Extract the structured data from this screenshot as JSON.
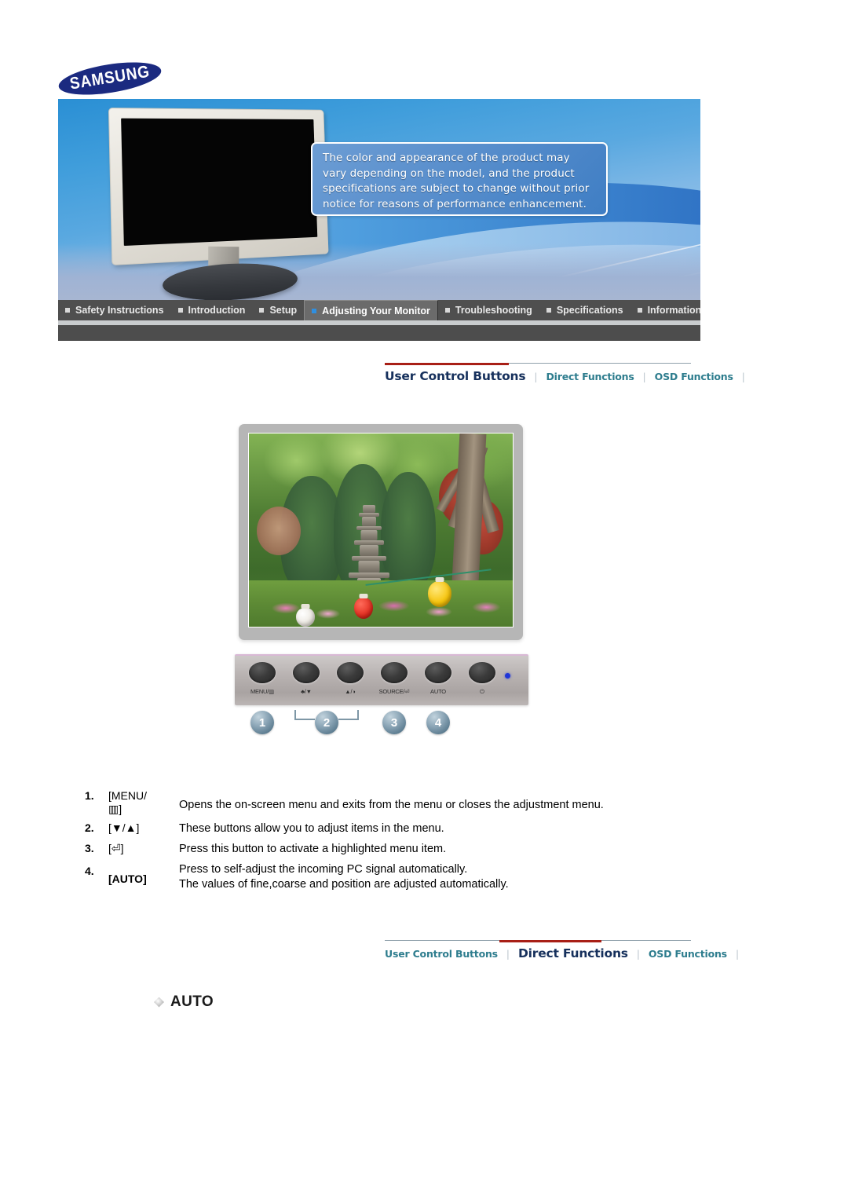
{
  "brand": {
    "logo_text": "SAMSUNG"
  },
  "header": {
    "disclaimer": "The color and appearance of the product may vary depending on the model, and the product specifications are subject to change without prior notice for reasons of performance enhancement."
  },
  "nav": {
    "items": [
      {
        "label": "Safety Instructions",
        "active": false
      },
      {
        "label": "Introduction",
        "active": false
      },
      {
        "label": "Setup",
        "active": false
      },
      {
        "label": "Adjusting Your Monitor",
        "active": true
      },
      {
        "label": "Troubleshooting",
        "active": false
      },
      {
        "label": "Specifications",
        "active": false
      },
      {
        "label": "Information",
        "active": false
      }
    ]
  },
  "tabs_top": {
    "items": [
      {
        "label": "User Control Buttons",
        "active": true
      },
      {
        "label": "Direct Functions",
        "active": false
      },
      {
        "label": "OSD Functions",
        "active": false
      }
    ],
    "separator": "|"
  },
  "tabs_bottom": {
    "items": [
      {
        "label": "User Control Buttons",
        "active": false
      },
      {
        "label": "Direct Functions",
        "active": true
      },
      {
        "label": "OSD Functions",
        "active": false
      }
    ],
    "separator": "|"
  },
  "control_panel": {
    "buttons": [
      {
        "label": "MENU/▥",
        "callout": "1"
      },
      {
        "label": "♣/▼",
        "callout": "2"
      },
      {
        "label": "▲/◑",
        "callout": "2"
      },
      {
        "label": "SOURCE/⏎",
        "callout": "3"
      },
      {
        "label": "AUTO",
        "callout": "4"
      },
      {
        "label": "⏻",
        "callout": ""
      }
    ],
    "callouts": [
      "1",
      "2",
      "3",
      "4"
    ],
    "led_color": "#1f35d8"
  },
  "instructions": [
    {
      "num": "1.",
      "key": "[MENU/▀▀]",
      "key_line1": "[MENU/",
      "key_line2": "▥]",
      "desc": "Opens the on-screen menu and exits from the menu or closes the adjustment menu.",
      "desc2": ""
    },
    {
      "num": "2.",
      "key": "[▼/▲]",
      "key_line1": "[▼/▲]",
      "key_line2": "",
      "desc": "These buttons allow you to adjust items in the menu.",
      "desc2": ""
    },
    {
      "num": "3.",
      "key": "[⏎]",
      "key_line1": "[⏎]",
      "key_line2": "",
      "desc": "Press this button to activate a highlighted menu item.",
      "desc2": ""
    },
    {
      "num": "4.",
      "key": "[AUTO]",
      "key_line1": "[AUTO]",
      "key_line2": "",
      "desc": "Press to self-adjust the incoming PC signal automatically.",
      "desc2": "The values of fine,coarse and position are adjusted automatically."
    }
  ],
  "section": {
    "auto_heading": "AUTO"
  },
  "colors": {
    "nav_bar": "#4f4f4f",
    "nav_active": "#6b6b6b",
    "accent_red": "#a81f16",
    "tab_teal": "#2e7d8e",
    "tab_navy": "#16305c",
    "samsung_blue": "#1b2a80",
    "led_blue": "#1f35d8"
  }
}
